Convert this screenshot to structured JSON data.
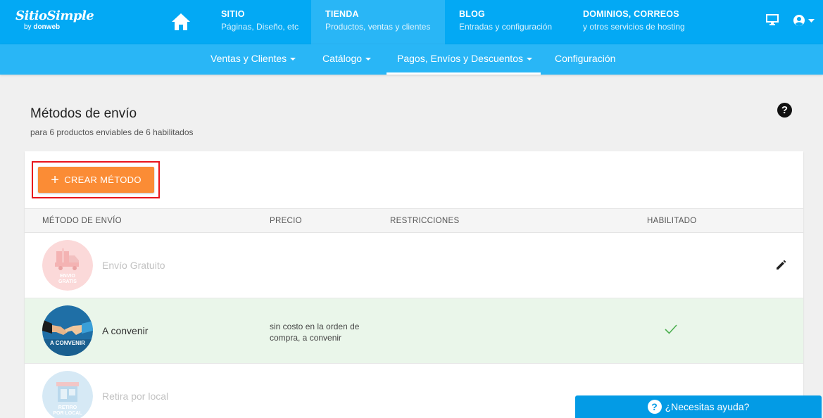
{
  "brand": {
    "name": "SitioSimple",
    "by": "by",
    "company": "donweb"
  },
  "top_nav": [
    {
      "title": "SITIO",
      "subtitle": "Páginas, Diseño, etc"
    },
    {
      "title": "TIENDA",
      "subtitle": "Productos, ventas y clientes"
    },
    {
      "title": "BLOG",
      "subtitle": "Entradas y configuración"
    },
    {
      "title": "DOMINIOS, CORREOS",
      "subtitle": "y otros servicios de hosting"
    }
  ],
  "sub_nav": [
    {
      "label": "Ventas y Clientes"
    },
    {
      "label": "Catálogo"
    },
    {
      "label": "Pagos, Envíos y Descuentos"
    },
    {
      "label": "Configuración"
    }
  ],
  "page": {
    "title": "Métodos de envío",
    "subtitle": "para 6 productos enviables de 6 habilitados",
    "help": "?"
  },
  "create_button": {
    "label": "CREAR MÉTODO"
  },
  "table": {
    "headers": [
      "MÉTODO DE ENVÍO",
      "PRECIO",
      "RESTRICCIONES",
      "HABILITADO"
    ],
    "rows": [
      {
        "name": "Envío Gratuito",
        "badge_line1": "ENVIO",
        "badge_line2": "GRATIS",
        "price_line1": "",
        "price_line2": "",
        "enabled": false
      },
      {
        "name": "A convenir",
        "badge_line1": "A CONVENIR",
        "badge_line2": "",
        "price_line1": "sin costo en la orden de",
        "price_line2": "compra, a convenir",
        "enabled": true
      },
      {
        "name": "Retira por local",
        "badge_line1": "RETIRO",
        "badge_line2": "POR LOCAL",
        "price_line1": "",
        "price_line2": "",
        "enabled": false
      }
    ]
  },
  "chat": {
    "label": "¿Necesitas ayuda?",
    "icon": "?"
  },
  "colors": {
    "topbar": "#03a9f4",
    "subbar": "#29b6f6",
    "accent": "#fb8c35",
    "highlight": "#e8141c",
    "enabled_row": "#eaf6ea"
  }
}
